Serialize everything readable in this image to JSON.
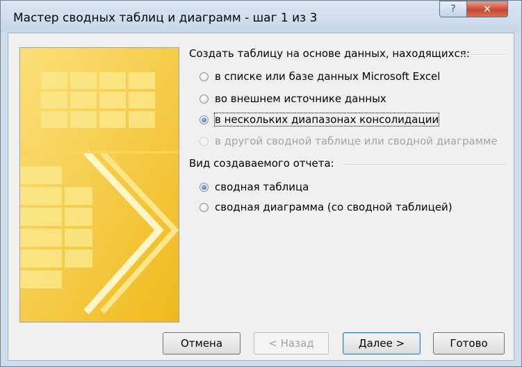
{
  "window": {
    "title": "Мастер сводных таблиц и диаграмм - шаг 1 из 3",
    "help_glyph": "?",
    "close_glyph": "✕"
  },
  "source": {
    "heading": "Создать таблицу на основе данных, находящихся:",
    "options": [
      {
        "label": "в списке или базе данных Microsoft Excel",
        "selected": false,
        "enabled": true
      },
      {
        "label": "во внешнем источнике данных",
        "selected": false,
        "enabled": true
      },
      {
        "label": "в нескольких диапазонах консолидации",
        "selected": true,
        "enabled": true
      },
      {
        "label": "в другой сводной таблице или сводной диаграмме",
        "selected": false,
        "enabled": false
      }
    ]
  },
  "report": {
    "heading": "Вид создаваемого отчета:",
    "options": [
      {
        "label": "сводная таблица",
        "selected": true,
        "enabled": true
      },
      {
        "label": "сводная диаграмма (со сводной таблицей)",
        "selected": false,
        "enabled": true
      }
    ]
  },
  "buttons": {
    "cancel": "Отмена",
    "back": "< Назад",
    "next": "Далее >",
    "finish": "Готово"
  },
  "colors": {
    "art_yellow": "#f5ca2a",
    "art_light": "#fbe98d",
    "default_button_border": "#3c7fb1"
  }
}
